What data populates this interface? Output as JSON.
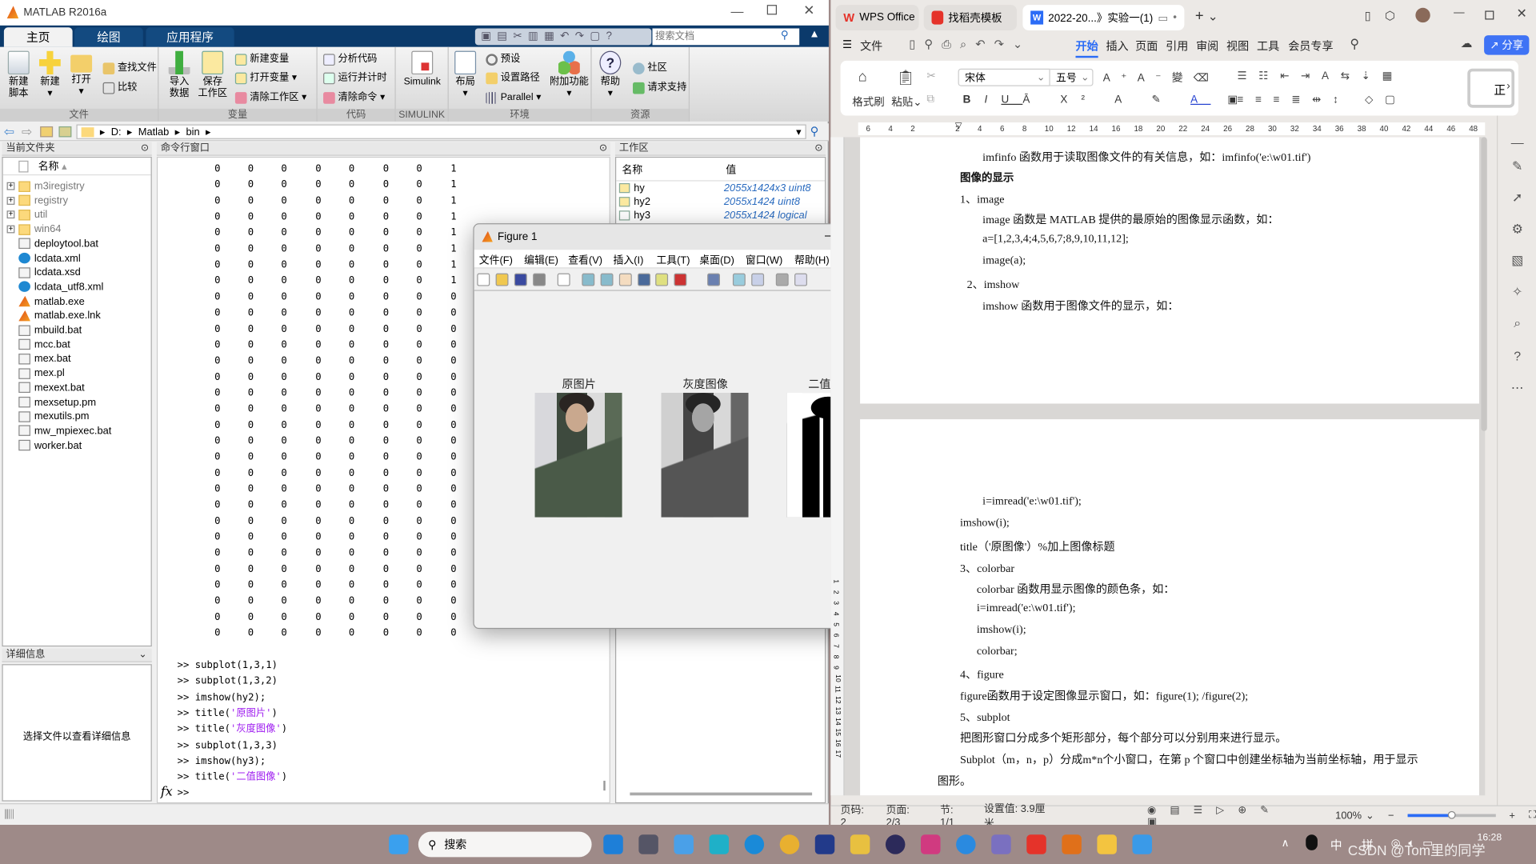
{
  "matlab": {
    "title": "MATLAB R2016a",
    "tabs": [
      "主页",
      "绘图",
      "应用程序"
    ],
    "search_placeholder": "搜索文档",
    "ribbon": {
      "groups": [
        "文件",
        "变量",
        "代码",
        "SIMULINK",
        "环境",
        "资源"
      ],
      "new_script": "新建\n脚本",
      "new": "新建",
      "open": "打开",
      "find_files": "查找文件",
      "compare": "比较",
      "import": "导入\n数据",
      "save_ws": "保存\n工作区",
      "new_var": "新建变量",
      "open_var": "打开变量",
      "clear_ws": "清除工作区",
      "analyze": "分析代码",
      "run_time": "运行并计时",
      "clear_cmd": "清除命令",
      "simulink": "Simulink",
      "layout": "布局",
      "prefs": "预设",
      "set_path": "设置路径",
      "parallel": "Parallel",
      "addons": "附加功能",
      "help": "帮助",
      "community": "社区",
      "support": "请求支持"
    },
    "address": [
      "D:",
      "Matlab",
      "bin"
    ],
    "current_folder": {
      "title": "当前文件夹",
      "col_name": "名称",
      "items": [
        {
          "name": "m3iregistry",
          "icon": "folder"
        },
        {
          "name": "registry",
          "icon": "folder"
        },
        {
          "name": "util",
          "icon": "folder"
        },
        {
          "name": "win64",
          "icon": "folder"
        },
        {
          "name": "deploytool.bat",
          "icon": "bat"
        },
        {
          "name": "lcdata.xml",
          "icon": "edge"
        },
        {
          "name": "lcdata.xsd",
          "icon": "schema"
        },
        {
          "name": "lcdata_utf8.xml",
          "icon": "edge"
        },
        {
          "name": "matlab.exe",
          "icon": "matlab"
        },
        {
          "name": "matlab.exe.lnk",
          "icon": "matlab"
        },
        {
          "name": "mbuild.bat",
          "icon": "bat"
        },
        {
          "name": "mcc.bat",
          "icon": "bat"
        },
        {
          "name": "mex.bat",
          "icon": "bat"
        },
        {
          "name": "mex.pl",
          "icon": "file"
        },
        {
          "name": "mexext.bat",
          "icon": "bat"
        },
        {
          "name": "mexsetup.pm",
          "icon": "file"
        },
        {
          "name": "mexutils.pm",
          "icon": "file"
        },
        {
          "name": "mw_mpiexec.bat",
          "icon": "bat"
        },
        {
          "name": "worker.bat",
          "icon": "bat"
        }
      ]
    },
    "details": {
      "title": "详细信息",
      "message": "选择文件以查看详细信息"
    },
    "command_window": {
      "title": "命令行窗口",
      "matrix": [
        [
          0,
          0,
          0,
          0,
          0,
          0,
          0,
          1
        ],
        [
          0,
          0,
          0,
          0,
          0,
          0,
          0,
          1
        ],
        [
          0,
          0,
          0,
          0,
          0,
          0,
          0,
          1
        ],
        [
          0,
          0,
          0,
          0,
          0,
          0,
          0,
          1
        ],
        [
          0,
          0,
          0,
          0,
          0,
          0,
          0,
          1
        ],
        [
          0,
          0,
          0,
          0,
          0,
          0,
          0,
          1
        ],
        [
          0,
          0,
          0,
          0,
          0,
          0,
          0,
          1
        ],
        [
          0,
          0,
          0,
          0,
          0,
          0,
          0,
          1
        ],
        [
          0,
          0,
          0,
          0,
          0,
          0,
          0,
          0
        ],
        [
          0,
          0,
          0,
          0,
          0,
          0,
          0,
          0
        ],
        [
          0,
          0,
          0,
          0,
          0,
          0,
          0,
          0
        ],
        [
          0,
          0,
          0,
          0,
          0,
          0,
          0,
          0
        ],
        [
          0,
          0,
          0,
          0,
          0,
          0,
          0,
          0
        ],
        [
          0,
          0,
          0,
          0,
          0,
          0,
          0,
          0
        ],
        [
          0,
          0,
          0,
          0,
          0,
          0,
          0,
          0
        ],
        [
          0,
          0,
          0,
          0,
          0,
          0,
          0,
          0
        ],
        [
          0,
          0,
          0,
          0,
          0,
          0,
          0,
          0
        ],
        [
          0,
          0,
          0,
          0,
          0,
          0,
          0,
          0
        ],
        [
          0,
          0,
          0,
          0,
          0,
          0,
          0,
          0
        ],
        [
          0,
          0,
          0,
          0,
          0,
          0,
          0,
          0
        ],
        [
          0,
          0,
          0,
          0,
          0,
          0,
          0,
          0
        ],
        [
          0,
          0,
          0,
          0,
          0,
          0,
          0,
          0
        ],
        [
          0,
          0,
          0,
          0,
          0,
          0,
          0,
          0
        ],
        [
          0,
          0,
          0,
          0,
          0,
          0,
          0,
          0
        ],
        [
          0,
          0,
          0,
          0,
          0,
          0,
          0,
          0
        ],
        [
          0,
          0,
          0,
          0,
          0,
          0,
          0,
          0
        ],
        [
          0,
          0,
          0,
          0,
          0,
          0,
          0,
          0
        ],
        [
          0,
          0,
          0,
          0,
          0,
          0,
          0,
          0
        ],
        [
          0,
          0,
          0,
          0,
          0,
          0,
          0,
          0
        ],
        [
          0,
          0,
          0,
          0,
          0,
          0,
          0,
          0
        ]
      ],
      "history": [
        {
          "prompt": ">>",
          "code": "subplot(1,3,1)",
          "str": ""
        },
        {
          "prompt": ">>",
          "code": "subplot(1,3,2)",
          "str": ""
        },
        {
          "prompt": ">>",
          "code": "imshow(hy2);",
          "str": ""
        },
        {
          "prompt": ">>",
          "code": "title(",
          "str": "'原图片'",
          "end": ")"
        },
        {
          "prompt": ">>",
          "code": "title(",
          "str": "'灰度图像'",
          "end": ")"
        },
        {
          "prompt": ">>",
          "code": "subplot(1,3,3)",
          "str": ""
        },
        {
          "prompt": ">>",
          "code": "imshow(hy3);",
          "str": ""
        },
        {
          "prompt": ">>",
          "code": "title(",
          "str": "'二值图像'",
          "end": ")"
        }
      ],
      "prompt": ">>",
      "fx": "fx"
    },
    "workspace": {
      "title": "工作区",
      "col_name": "名称",
      "col_value": "值",
      "vars": [
        {
          "name": "hy",
          "value": "2055x1424x3 uint8",
          "icon": "matrix"
        },
        {
          "name": "hy2",
          "value": "2055x1424 uint8",
          "icon": "matrix"
        },
        {
          "name": "hy3",
          "value": "2055x1424 logical",
          "icon": "logical"
        }
      ]
    }
  },
  "figure": {
    "title": "Figure 1",
    "menu": [
      "文件(F)",
      "编辑(E)",
      "查看(V)",
      "插入(I)",
      "工具(T)",
      "桌面(D)",
      "窗口(W)",
      "帮助(H)"
    ],
    "subplot_titles": [
      "原图片",
      "灰度图像",
      "二值图像"
    ]
  },
  "wps": {
    "tabs": [
      "WPS Office",
      "找稻壳模板",
      "2022-20...》实验一(1)"
    ],
    "menu": [
      "文件",
      "开始",
      "插入",
      "页面",
      "引用",
      "审阅",
      "视图",
      "工具",
      "会员专享"
    ],
    "active_menu": "开始",
    "share": "分享",
    "font": "宋体",
    "font_size": "五号",
    "format_painter": "格式刷",
    "paste": "粘贴",
    "style_preview": "正",
    "ruler": [
      "6",
      "4",
      "2",
      "",
      "2",
      "4",
      "6",
      "8",
      "10",
      "12",
      "14",
      "16",
      "18",
      "20",
      "22",
      "24",
      "26",
      "28",
      "30",
      "32",
      "34",
      "36",
      "38",
      "40",
      "42",
      "44",
      "46",
      "48"
    ],
    "vruler": [
      "1",
      "2",
      "3",
      "4",
      "5",
      "6",
      "7",
      "8",
      "9",
      "10",
      "11",
      "12",
      "13",
      "14",
      "15",
      "16",
      "17"
    ],
    "doc_lines": [
      "imfinfo 函数用于读取图像文件的有关信息，如：imfinfo('e:\\w01.tif')",
      "图像的显示",
      "1、image",
      "image 函数是 MATLAB 提供的最原始的图像显示函数，如：",
      "a=[1,2,3,4;4,5,6,7;8,9,10,11,12];",
      "image(a);",
      "2、imshow",
      "imshow 函数用于图像文件的显示，如：",
      "i=imread('e:\\w01.tif');",
      "imshow(i);",
      "title（'原图像'）%加上图像标题",
      "3、colorbar",
      "colorbar 函数用显示图像的颜色条，如：",
      "i=imread('e:\\w01.tif');",
      "imshow(i);",
      "colorbar;",
      "4、figure",
      "figure函数用于设定图像显示窗口，如：figure(1);   /figure(2);",
      "5、subplot",
      "把图形窗口分成多个矩形部分，每个部分可以分别用来进行显示。",
      "Subplot（m，n，p）分成m*n个小窗口，在第 p 个窗口中创建坐标轴为当前坐标轴，用于显示",
      "图形。"
    ],
    "status": {
      "page_no": "页码: 2",
      "pages": "页面: 2/3",
      "section": "节: 1/1",
      "setting": "设置值: 3.9厘米",
      "zoom": "100%"
    },
    "zoom_level": 0.5,
    "accent": "#2b6cf6"
  },
  "taskbar": {
    "search": "搜索",
    "apps": [
      "start",
      "calendar",
      "calculator",
      "file-manager",
      "desktop",
      "edge",
      "chrome",
      "dev-cpp",
      "app-swirl",
      "eclipse",
      "intellij",
      "app-ring",
      "dolphin",
      "wps",
      "matlab",
      "file-explorer",
      "photos"
    ],
    "tray": {
      "ime1": "中",
      "ime2": "拼",
      "time": "16:28"
    },
    "watermark": "CSDN @Tom里的同学"
  }
}
